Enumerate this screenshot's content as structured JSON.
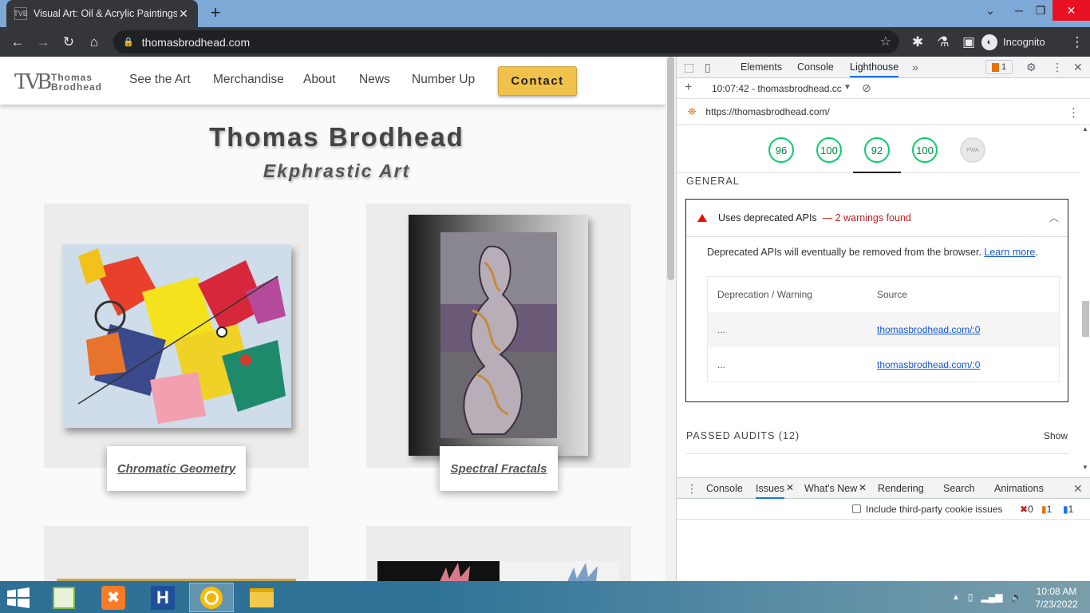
{
  "browser": {
    "tab_title": "Visual Art: Oil & Acrylic Paintings",
    "tab_favicon": "TVB",
    "url": "thomasbrodhead.com",
    "profile_label": "Incognito"
  },
  "site": {
    "logo_mark": "TVB",
    "logo_name_line1": "Thomas",
    "logo_name_line2": "Brodhead",
    "nav": [
      "See the Art",
      "Merchandise",
      "About",
      "News",
      "Number Up"
    ],
    "contact_label": "Contact",
    "title": "Thomas Brodhead",
    "subtitle": "Ekphrastic Art",
    "gallery": [
      {
        "caption": "Chromatic Geometry"
      },
      {
        "caption": "Spectral Fractals"
      }
    ]
  },
  "devtools": {
    "tabs": [
      "Elements",
      "Console",
      "Lighthouse"
    ],
    "active_tab": "Lighthouse",
    "issues_count": "1",
    "report_time": "10:07:42 - thomasbrodhead.cc",
    "report_url": "https://thomasbrodhead.com/",
    "scores": [
      "96",
      "100",
      "92",
      "100",
      "PWA"
    ],
    "section_general": "GENERAL",
    "audit_title": "Uses deprecated APIs",
    "audit_warning": "— 2 warnings found",
    "audit_desc": "Deprecated APIs will eventually be removed from the browser.",
    "learn_more": "Learn more",
    "table_headers": [
      "Deprecation / Warning",
      "Source"
    ],
    "table_rows": [
      {
        "warning": "...",
        "source": "thomasbrodhead.com/:0"
      },
      {
        "warning": "...",
        "source": "thomasbrodhead.com/:0"
      }
    ],
    "passed_title": "PASSED AUDITS (12)",
    "show_label": "Show",
    "drawer_tabs": [
      "Console",
      "Issues",
      "What's New",
      "Rendering",
      "Search",
      "Animations"
    ],
    "third_party_label": "Include third-party cookie issues",
    "counts": {
      "errors": "0",
      "warnings": "1",
      "info": "1"
    }
  },
  "taskbar": {
    "time": "10:08 AM",
    "date": "7/23/2022"
  },
  "colors": {
    "accent": "#1a73e8",
    "score_good": "#0cce6b",
    "warning": "#eb0f00",
    "contact_button": "#f0c14b"
  }
}
